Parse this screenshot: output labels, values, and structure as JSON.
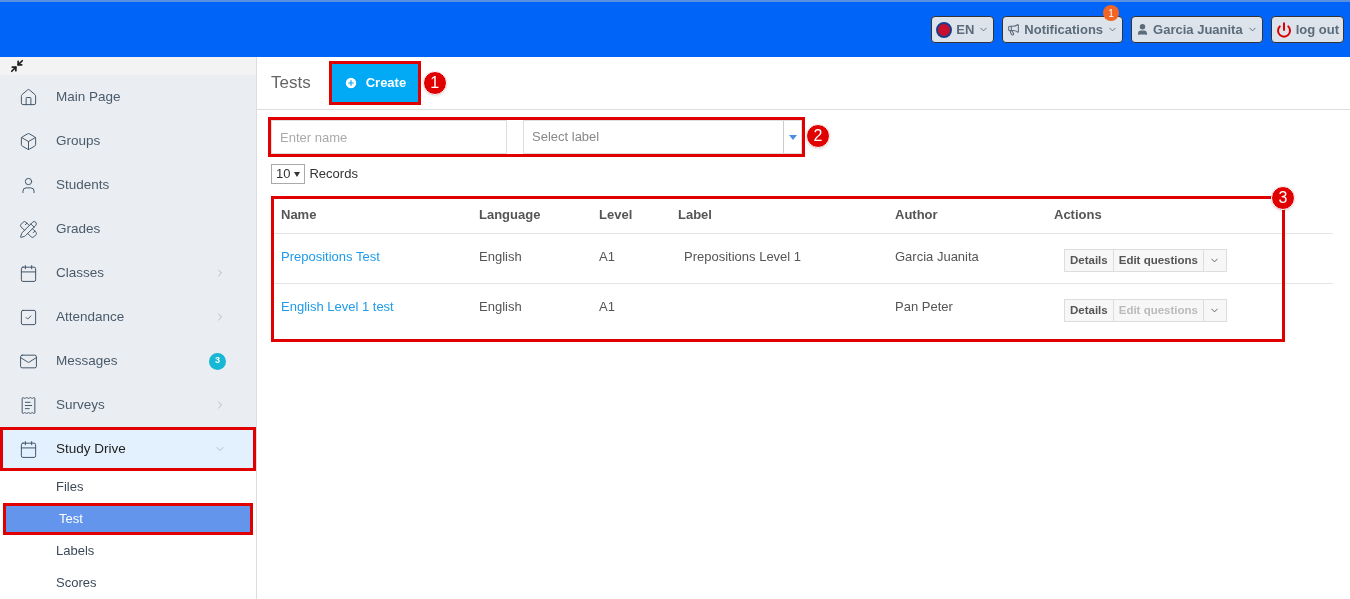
{
  "topbar": {
    "language": "EN",
    "notifications": {
      "label": "Notifications",
      "count": "1"
    },
    "user": "Garcia Juanita",
    "logout": "log out"
  },
  "sidebar": {
    "items": [
      {
        "label": "Main Page",
        "has_arrow": false,
        "selected": false,
        "highlighted": false
      },
      {
        "label": "Groups",
        "has_arrow": false,
        "selected": false,
        "highlighted": false
      },
      {
        "label": "Students",
        "has_arrow": false,
        "selected": false,
        "highlighted": false
      },
      {
        "label": "Grades",
        "has_arrow": false,
        "selected": false,
        "highlighted": false
      },
      {
        "label": "Classes",
        "has_arrow": true,
        "expanded": false,
        "selected": false,
        "highlighted": false
      },
      {
        "label": "Attendance",
        "has_arrow": true,
        "expanded": false,
        "selected": false,
        "highlighted": false
      },
      {
        "label": "Messages",
        "has_arrow": false,
        "selected": false,
        "highlighted": false,
        "badge": "3"
      },
      {
        "label": "Surveys",
        "has_arrow": true,
        "expanded": false,
        "selected": false,
        "highlighted": false
      },
      {
        "label": "Study Drive",
        "has_arrow": true,
        "expanded": true,
        "selected": true,
        "highlighted": true,
        "children": [
          {
            "label": "Files",
            "selected": false,
            "highlighted": false
          },
          {
            "label": "Test",
            "selected": true,
            "highlighted": true
          },
          {
            "label": "Labels",
            "selected": false,
            "highlighted": false
          },
          {
            "label": "Scores",
            "selected": false,
            "highlighted": false
          }
        ]
      }
    ]
  },
  "page": {
    "title": "Tests",
    "create": {
      "label": "Create",
      "highlighted": true,
      "annotation": "1"
    },
    "filters": {
      "name_placeholder": "Enter name",
      "label_placeholder": "Select label",
      "highlighted": true,
      "annotation": "2"
    },
    "records": {
      "value": "10",
      "label": "Records"
    },
    "table": {
      "highlighted": true,
      "annotation": "3",
      "columns": [
        "Name",
        "Language",
        "Level",
        "Label",
        "Author",
        "Actions"
      ],
      "rows": [
        {
          "name": "Prepositions Test",
          "language": "English",
          "level": "A1",
          "label": "Prepositions Level 1",
          "author": "Garcia Juanita",
          "details": "Details",
          "edit": "Edit questions",
          "edit_disabled": false
        },
        {
          "name": "English Level 1 test",
          "language": "English",
          "level": "A1",
          "author": "Pan Peter",
          "details": "Details",
          "edit": "Edit questions",
          "edit_disabled": true
        }
      ]
    }
  }
}
